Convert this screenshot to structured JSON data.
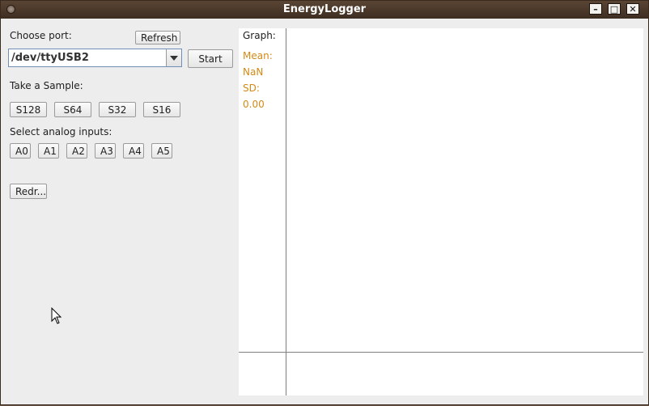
{
  "window": {
    "title": "EnergyLogger"
  },
  "port": {
    "label": "Choose port:",
    "refresh_label": "Refresh",
    "selected": "/dev/ttyUSB2",
    "start_label": "Start"
  },
  "sample": {
    "label": "Take a Sample:",
    "buttons": [
      "S128",
      "S64",
      "S32",
      "S16"
    ]
  },
  "analog": {
    "label": "Select analog inputs:",
    "buttons": [
      "A0",
      "A1",
      "A2",
      "A3",
      "A4",
      "A5"
    ]
  },
  "redraw_label": "Redr...",
  "graph": {
    "label": "Graph:",
    "mean_label": "Mean:",
    "mean_value": "NaN",
    "sd_label": "SD:",
    "sd_value": "0.00"
  },
  "icons": {
    "window": [
      "minimize-icon",
      "maximize-icon",
      "close-icon"
    ],
    "combo": "chevron-down-icon",
    "pointer": "mouse-pointer-icon"
  },
  "colors": {
    "stats": "#d28a16",
    "titlebar": "#4a3829"
  }
}
